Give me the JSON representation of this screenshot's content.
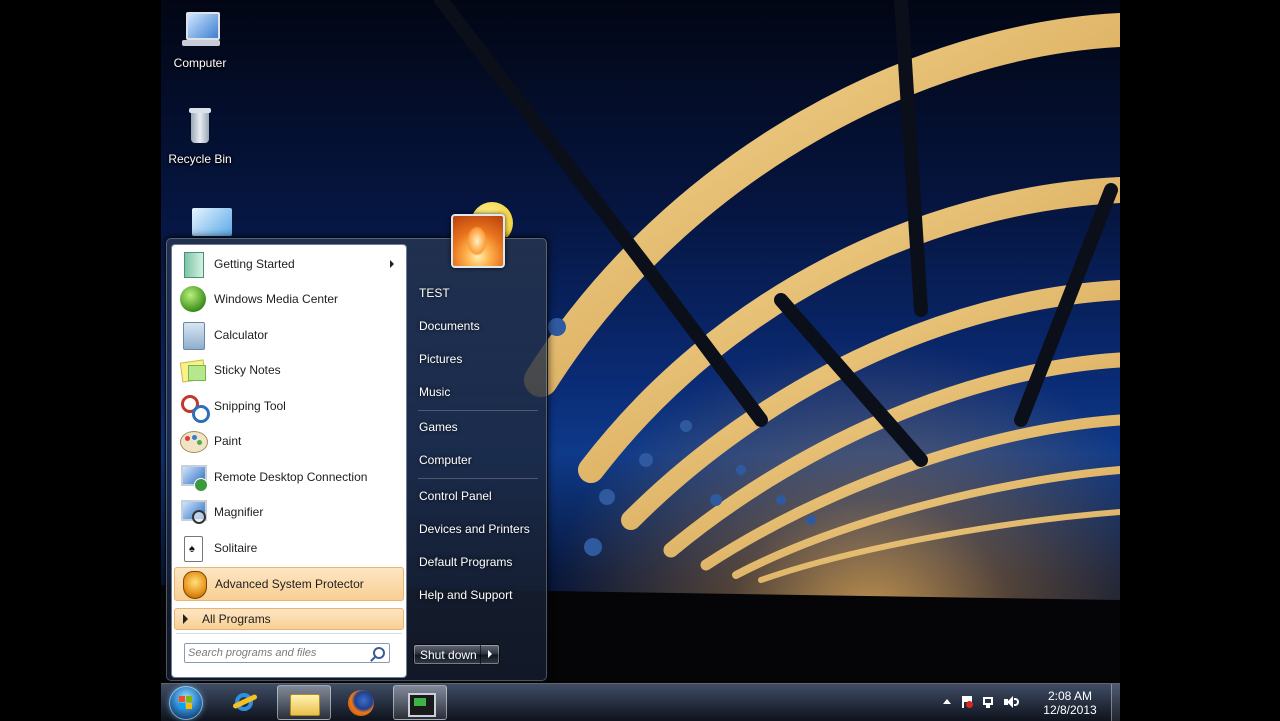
{
  "desktop": {
    "icons": [
      {
        "label": "Computer",
        "icon": "computer-icon"
      },
      {
        "label": "Recycle Bin",
        "icon": "recycle-bin-icon"
      },
      {
        "label": "",
        "icon": "desktop-shortcut-icon"
      }
    ]
  },
  "start_menu": {
    "programs": [
      {
        "label": "Getting Started",
        "icon": "getting-started-icon",
        "has_submenu": true
      },
      {
        "label": "Windows Media Center",
        "icon": "media-center-icon"
      },
      {
        "label": "Calculator",
        "icon": "calculator-icon"
      },
      {
        "label": "Sticky Notes",
        "icon": "sticky-notes-icon"
      },
      {
        "label": "Snipping Tool",
        "icon": "snipping-tool-icon"
      },
      {
        "label": "Paint",
        "icon": "paint-icon"
      },
      {
        "label": "Remote Desktop Connection",
        "icon": "remote-desktop-icon"
      },
      {
        "label": "Magnifier",
        "icon": "magnifier-icon"
      },
      {
        "label": "Solitaire",
        "icon": "solitaire-icon"
      },
      {
        "label": "Advanced System Protector",
        "icon": "shield-icon",
        "highlighted": true
      }
    ],
    "all_programs_label": "All Programs",
    "search_placeholder": "Search programs and files",
    "right_links": [
      {
        "label": "TEST"
      },
      {
        "label": "Documents"
      },
      {
        "label": "Pictures"
      },
      {
        "label": "Music"
      },
      {
        "label": "Games"
      },
      {
        "label": "Computer"
      },
      {
        "label": "Control Panel"
      },
      {
        "label": "Devices and Printers"
      },
      {
        "label": "Default Programs"
      },
      {
        "label": "Help and Support"
      }
    ],
    "shutdown_label": "Shut down"
  },
  "taskbar": {
    "pinned": [
      {
        "icon": "internet-explorer-icon"
      },
      {
        "icon": "windows-explorer-icon",
        "active": true
      },
      {
        "icon": "firefox-icon"
      },
      {
        "icon": "command-window-icon",
        "active": true
      }
    ],
    "tray": {
      "time": "2:08 AM",
      "date": "12/8/2013"
    }
  },
  "colors": {
    "highlight": "#f9cf93",
    "wallpaper_sky": "#0a2a73"
  }
}
